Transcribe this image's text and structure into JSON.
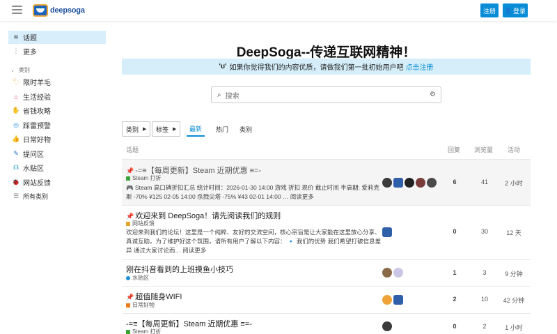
{
  "header": {
    "logo_text": "deepsoga",
    "signup_label": "注册",
    "login_label": "登录"
  },
  "sidebar": {
    "topics_label": "话题",
    "more_label": "更多",
    "categories_heading": "类别",
    "categories": [
      {
        "label": "限时羊毛",
        "icon": "coupon-icon",
        "color": "#e7c27a"
      },
      {
        "label": "生活经验",
        "icon": "home-icon",
        "color": "#e0397a"
      },
      {
        "label": "省钱攻略",
        "icon": "hand-icon",
        "color": "#3aa33a"
      },
      {
        "label": "踩雷预警",
        "icon": "target-icon",
        "color": "#1a8fd6"
      },
      {
        "label": "日常好物",
        "icon": "thumbs-up-icon",
        "color": "#f07a1a"
      },
      {
        "label": "提问区",
        "icon": "pencil-icon",
        "color": "#1a6fd6"
      },
      {
        "label": "水贴区",
        "icon": "headset-icon",
        "color": "#1a8fd6"
      },
      {
        "label": "网站反馈",
        "icon": "bug-icon",
        "color": "#e7a62a"
      }
    ],
    "all_categories_label": "所有类别"
  },
  "banner": {
    "title": "DeepSoga--传递互联网精神！",
    "subtitle_emoji": "'ʊ'",
    "subtitle_text": "如果你觉得我们的内容优质，请做我们第一批初始用户吧",
    "subtitle_link": "点击注册"
  },
  "search": {
    "placeholder": "搜索"
  },
  "filters": {
    "category_label": "类别",
    "tags_label": "标签",
    "tabs": [
      "最新",
      "热门",
      "类别"
    ]
  },
  "table": {
    "headers": {
      "topic": "话题",
      "replies": "回复",
      "views": "浏览量",
      "activity": "活动"
    },
    "rows": [
      {
        "title": "-=≡【每周更新】Steam 近期优惠 ≡=-",
        "pinned": true,
        "category": "Steam 打折",
        "category_color": "#3aa33a",
        "excerpt": "🎮 Steam 高口碑折扣汇总 统计时间：2026-01-30 14:00 游戏 折扣 现价 截止时间 半衰期: 爱莉克斯 -70% ¥125 02-05 14:00 杀戮尖塔 -75% ¥43 02-01 14:00 … 阅读更多",
        "replies": "6",
        "views": "41",
        "activity": "2 小时"
      },
      {
        "title": "欢迎来到 DeepSoga！请先阅读我们的规则",
        "pinned": true,
        "category": "网站反馈",
        "category_color": "#e7a62a",
        "excerpt": "欢迎来到我们的论坛！这里是一个纯粹、友好的交流空间，核心宗旨是让大家能在这里放心分享、真诚互助。为了维护好这个氛围，请所有用户了解以下内容： 🔹 我们的优势 我们希望打破信息差异 通过大家讨论而… 阅读更多",
        "replies": "0",
        "views": "30",
        "activity": "12 天"
      },
      {
        "title": "刚在抖音看到的上班摸鱼小技巧",
        "pinned": false,
        "category": "水贴区",
        "category_color": "#1a8fd6",
        "replies": "1",
        "views": "3",
        "activity": "9 分钟"
      },
      {
        "title": "超值随身WIFI",
        "pinned": true,
        "category": "日常好物",
        "category_color": "#f07a1a",
        "replies": "2",
        "views": "10",
        "activity": "42 分钟"
      },
      {
        "title": "-=≡【每周更新】Steam 近期优惠 ≡=-",
        "pinned": false,
        "category": "Steam 打折",
        "category_color": "#3aa33a",
        "replies": "0",
        "views": "2",
        "activity": "1 小时"
      }
    ]
  },
  "colors": {
    "accent": "#0a8cd6",
    "sidebar_active": "#d8eefb",
    "banner_bg": "#d6eefa"
  }
}
